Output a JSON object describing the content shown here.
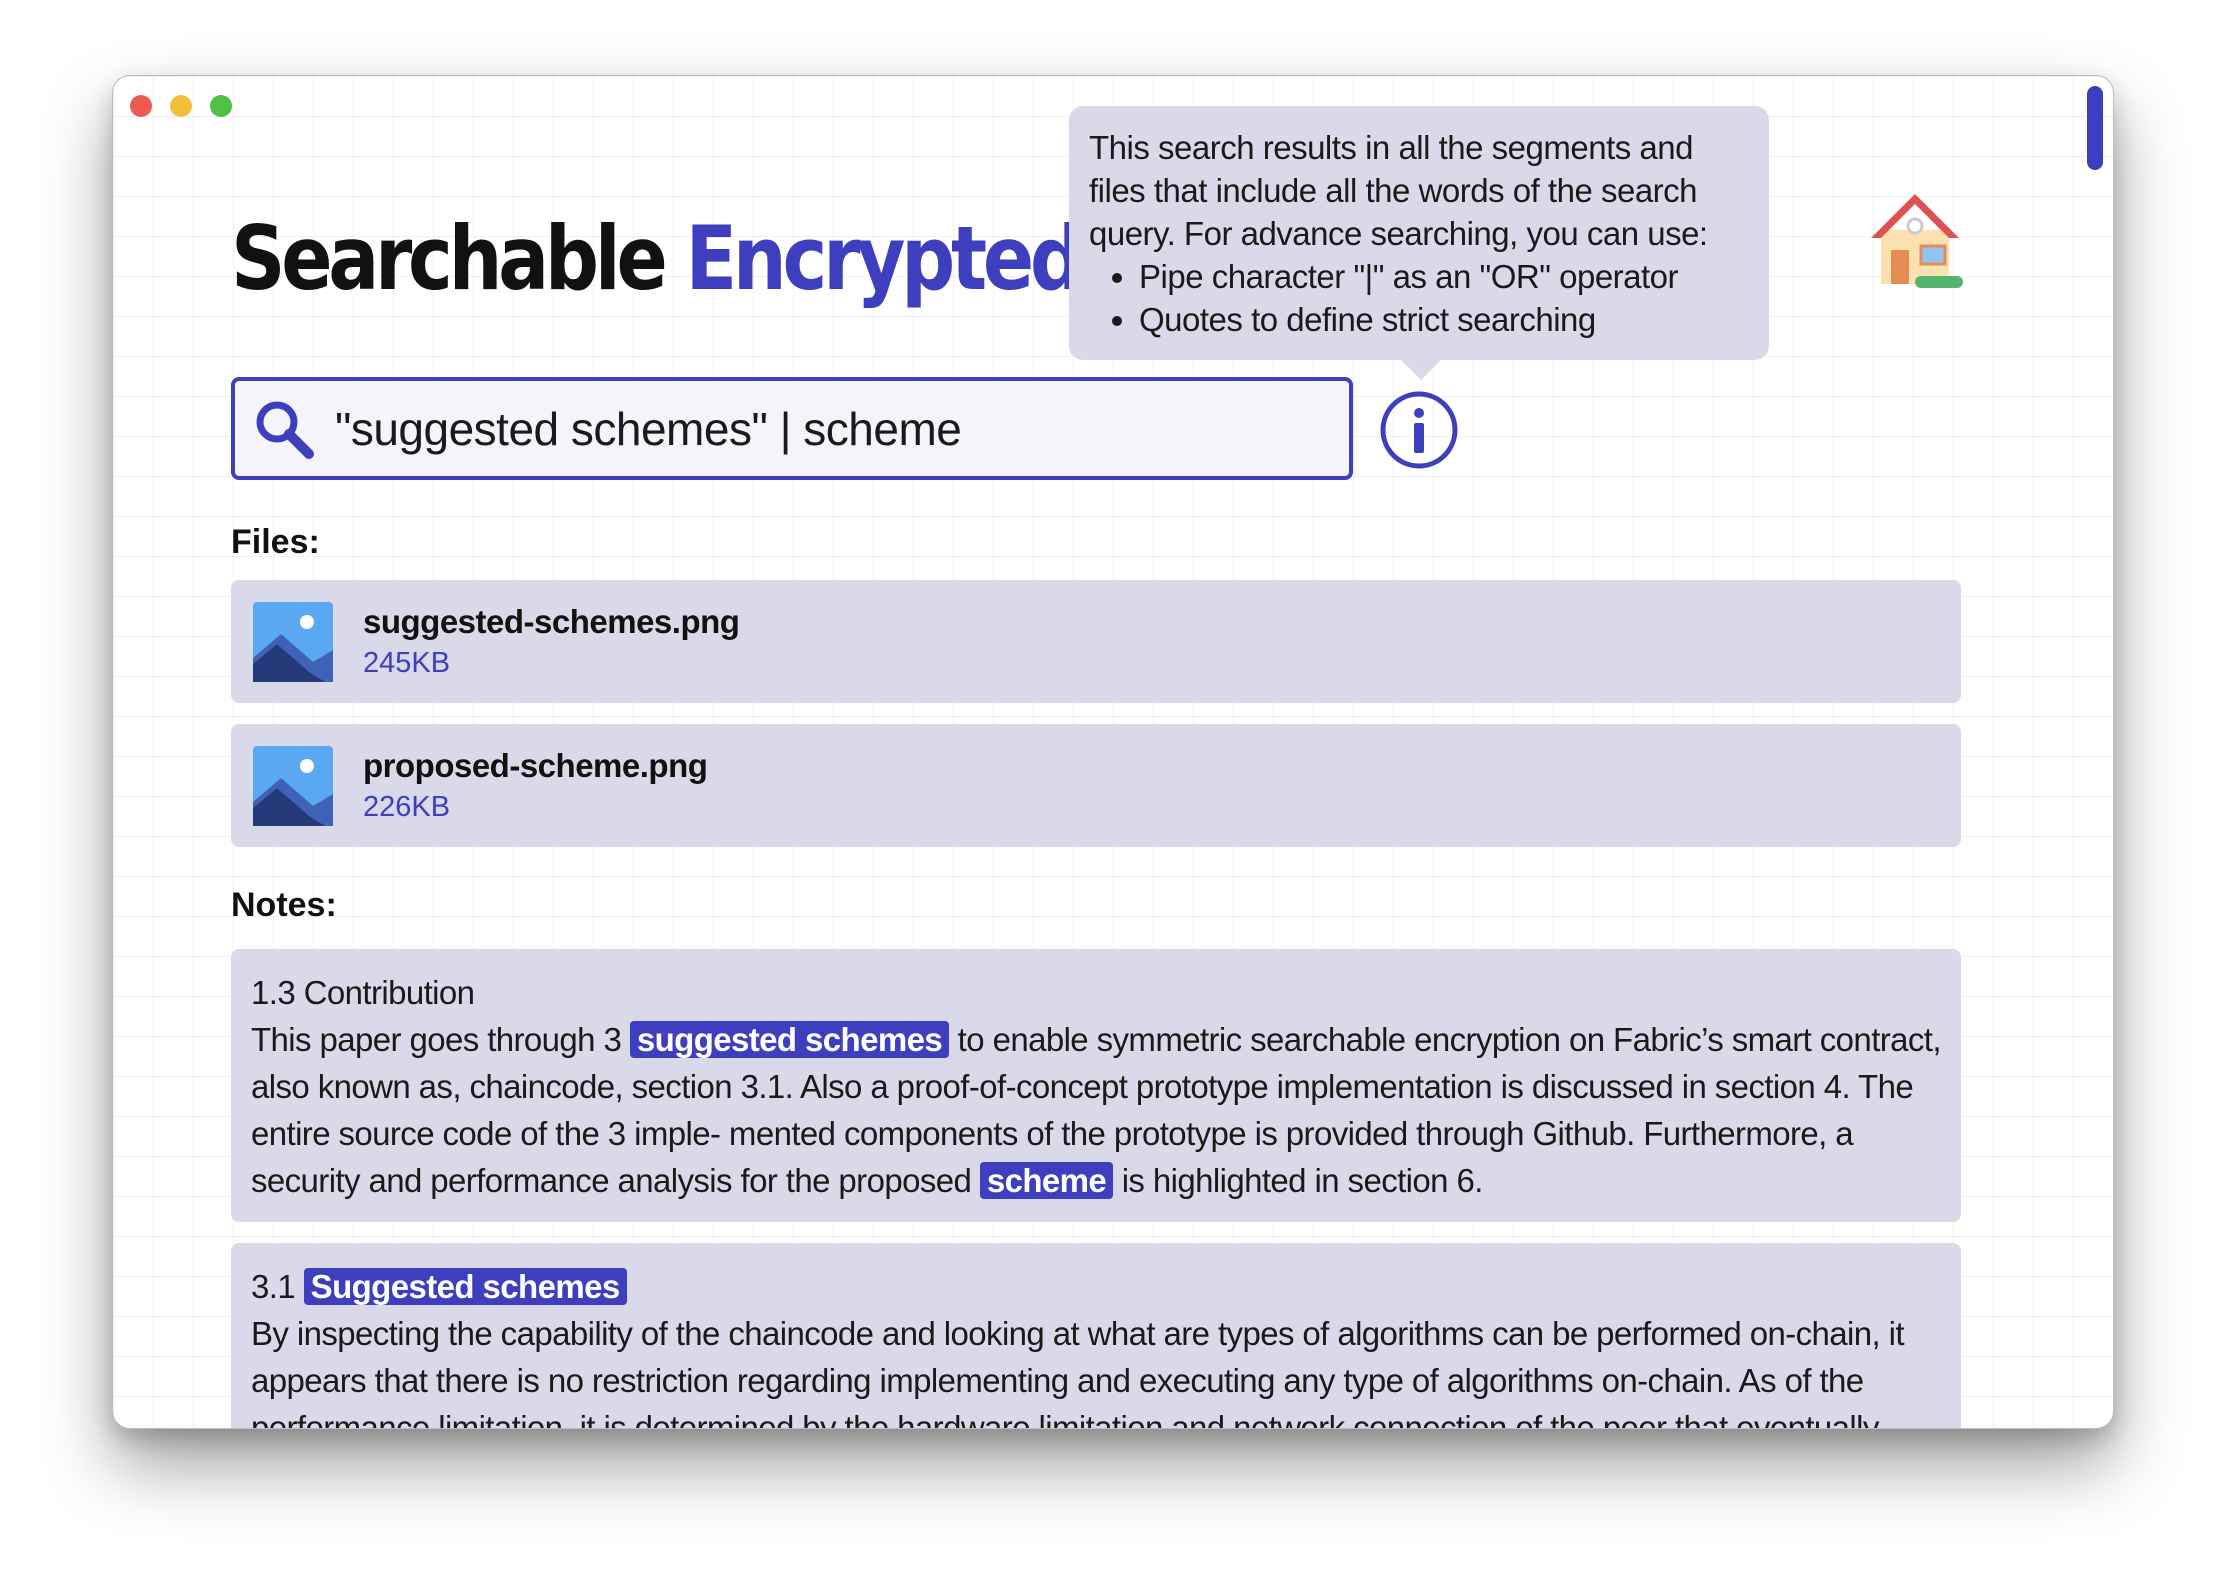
{
  "app": {
    "title_main": "Searchable",
    "title_accent": "Encrypted"
  },
  "tooltip": {
    "intro": "This search results in all the segments and files that include all the words of the search query. For advance searching, you can use:",
    "bullets": [
      "Pipe character \"|\" as an \"OR\" operator",
      "Quotes to define strict searching"
    ]
  },
  "search": {
    "value": "\"suggested schemes\" | scheme",
    "icon": "magnifier-icon",
    "info_icon": "info-icon"
  },
  "files": {
    "label": "Files:",
    "items": [
      {
        "name": "suggested-schemes.png",
        "size": "245KB",
        "icon": "image-file-icon"
      },
      {
        "name": "proposed-scheme.png",
        "size": "226KB",
        "icon": "image-file-icon"
      }
    ]
  },
  "notes": {
    "label": "Notes:",
    "items": [
      {
        "heading": "1.3 Contribution",
        "body": {
          "part1": "This paper goes through 3 ",
          "hl1": "suggested schemes",
          "part2": " to enable symmetric searchable encryption on Fabric’s smart contract, also known as, chaincode, section 3.1. Also a proof-of-concept prototype implementation is discussed in section 4. The entire source code of the 3 imple- mented components of the prototype is provided through Github. Furthermore, a security and performance analysis for the proposed ",
          "hl2": "scheme",
          "part3": " is highlighted in section 6."
        }
      },
      {
        "heading_prefix": "3.1 ",
        "heading_hl": "Suggested schemes",
        "body": "By inspecting the capability of the chaincode and looking at what are types of algorithms can be performed on-chain, it appears that there is no restriction regarding implementing and executing any type of algorithms on-chain. As of the performance limitation, it is determined by the hardware limitation and network connection of the peer that eventually"
      }
    ]
  },
  "colors": {
    "accent": "#3d3fbf",
    "card_bg": "#d9d9ea",
    "close": "#ee5b52",
    "minimize": "#f3be3a",
    "zoom": "#4fc145"
  }
}
